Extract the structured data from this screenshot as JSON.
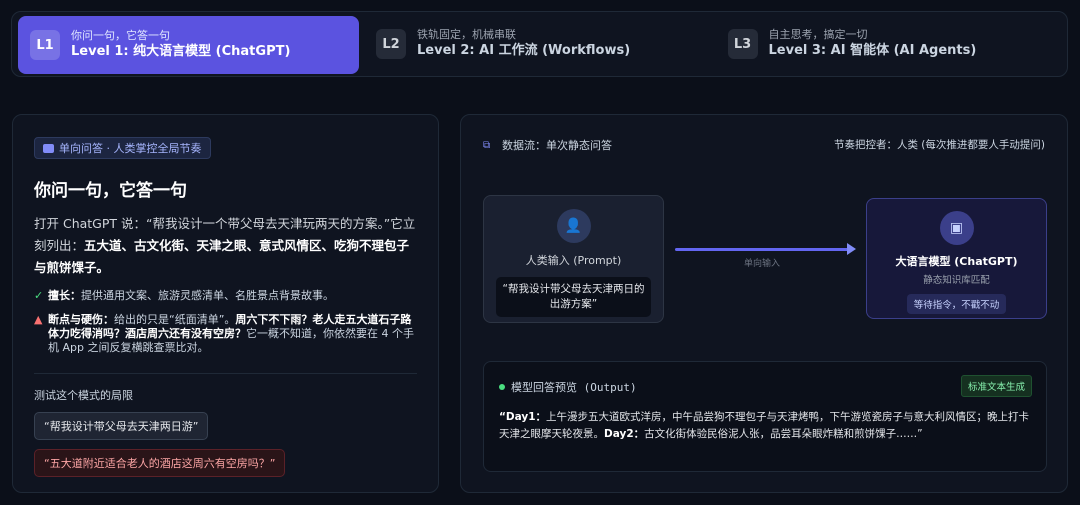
{
  "tabs": [
    {
      "badge": "L1",
      "line1": "你问一句，它答一句",
      "line2": "Level 1: 纯大语言模型 (ChatGPT)"
    },
    {
      "badge": "L2",
      "line1": "铁轨固定，机械串联",
      "line2": "Level 2: AI 工作流 (Workflows)"
    },
    {
      "badge": "L3",
      "line1": "自主思考，搞定一切",
      "line2": "Level 3: AI 智能体 (AI Agents)"
    }
  ],
  "left": {
    "pill": "单向问答 · 人类掌控全局节奏",
    "heading": "你问一句，它答一句",
    "desc_pre": "打开 ChatGPT 说：“帮我设计一个带父母去天津玩两天的方案。”它立刻列出：",
    "desc_bold": "五大道、古文化街、天津之眼、意式风情区、吃狗不理包子与煎饼馃子。",
    "pro_label": "擅长：",
    "pro_text": "提供通用文案、旅游灵感清单、名胜景点背景故事。",
    "con_label": "断点与硬伤：",
    "con_text1": "给出的只是“纸面清单”。",
    "con_bold": "周六下不下雨？老人走五大道石子路体力吃得消吗？酒店周六还有没有空房？",
    "con_text2": "它一概不知道，你依然要在 4 个手机 App 之间反复横跳查票比对。",
    "test_title": "测试这个模式的局限",
    "btn1": "“帮我设计带父母去天津两日游”",
    "btn2": "“五大道附近适合老人的酒店这周六有空房吗？”"
  },
  "right": {
    "flow_title": "数据流：单次静态问答",
    "tempo": "节奏把控者：人类 (每次推进都要人手动提问)",
    "human_label": "人类输入 (Prompt)",
    "human_quote": "“帮我设计带父母去天津两日的出游方案”",
    "arrow_label": "单向输入",
    "llm_label": "大语言模型 (ChatGPT)",
    "llm_sub": "静态知识库匹配",
    "llm_wait": "等待指令，不戳不动",
    "out_title": "模型回答预览 (Output)",
    "out_badge": "标准文本生成",
    "out_day1": "“Day1：",
    "out_text1": "上午漫步五大道欧式洋房，中午品尝狗不理包子与天津烤鸭，下午游览瓷房子与意大利风情区；晚上打卡天津之眼摩天轮夜景。",
    "out_day2": "Day2：",
    "out_text2": "古文化街体验民俗泥人张，品尝耳朵眼炸糕和煎饼馃子……”"
  }
}
